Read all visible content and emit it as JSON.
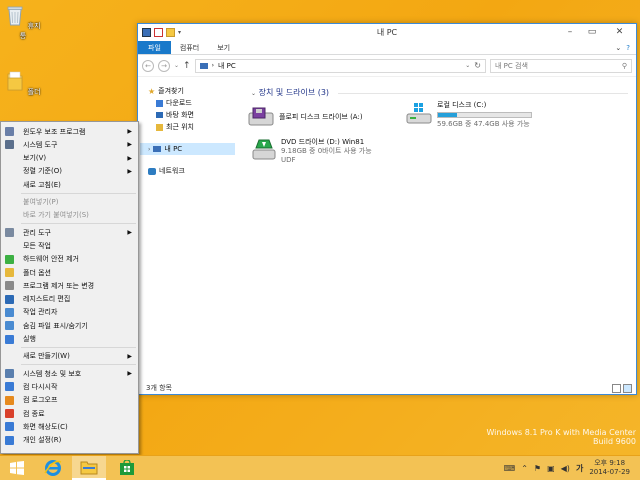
{
  "desktop": {
    "icons": [
      {
        "label": "휴지통",
        "icon": "recycle-bin-icon"
      },
      {
        "label": "폴더",
        "icon": "folder-icon"
      }
    ],
    "watermark": {
      "line1": "Windows 8.1 Pro K with Media Center",
      "line2": "Build 9600"
    }
  },
  "explorer": {
    "title": "내 PC",
    "ribbon_tabs": [
      "파일",
      "컴퓨터",
      "보기"
    ],
    "address": {
      "path": "내 PC",
      "search_placeholder": "내 PC 검색"
    },
    "nav_pane": {
      "favorites": "즐겨찾기",
      "favorite_items": [
        "다운로드",
        "바탕 화면",
        "최근 위치"
      ],
      "this_pc": "내 PC",
      "network": "네트워크"
    },
    "section_title": "장치 및 드라이브 (3)",
    "drives": [
      {
        "name": "플로피 디스크 드라이브 (A:)",
        "detail": "",
        "extra": ""
      },
      {
        "name": "로컬 디스크 (C:)",
        "detail": "59.6GB 중 47.4GB 사용 가능",
        "used_fraction": 0.2
      },
      {
        "name": "DVD 드라이브 (D:) Win81",
        "detail": "9.18GB 중 0바이트 사용 가능",
        "extra": "UDF"
      }
    ],
    "status": "3개 항목"
  },
  "context_menu": {
    "items": [
      {
        "label": "윈도우 보조 프로그램",
        "submenu": true,
        "disabled": false
      },
      {
        "label": "시스템 도구",
        "submenu": true,
        "disabled": false
      },
      {
        "label": "보기(V)",
        "submenu": true,
        "disabled": false
      },
      {
        "label": "정렬 기준(O)",
        "submenu": true,
        "disabled": false
      },
      {
        "label": "새로 고침(E)",
        "submenu": false,
        "disabled": false
      },
      {
        "label": "붙여넣기(P)",
        "submenu": false,
        "disabled": true
      },
      {
        "label": "바로 가기 붙여넣기(S)",
        "submenu": false,
        "disabled": true
      },
      {
        "label": "관리 도구",
        "submenu": true,
        "disabled": false
      },
      {
        "label": "모든 작업",
        "submenu": false,
        "disabled": false
      },
      {
        "label": "하드웨어 안전 제거",
        "submenu": false,
        "disabled": false
      },
      {
        "label": "폴더 옵션",
        "submenu": false,
        "disabled": false
      },
      {
        "label": "프로그램 제거 또는 변경",
        "submenu": false,
        "disabled": false
      },
      {
        "label": "레지스트리 편집",
        "submenu": false,
        "disabled": false
      },
      {
        "label": "작업 관리자",
        "submenu": false,
        "disabled": false
      },
      {
        "label": "숨김 파일 표시/숨기기",
        "submenu": false,
        "disabled": false
      },
      {
        "label": "실행",
        "submenu": false,
        "disabled": false
      },
      {
        "label": "새로 만들기(W)",
        "submenu": true,
        "disabled": false
      },
      {
        "label": "시스템 청소 및 보호",
        "submenu": true,
        "disabled": false
      },
      {
        "label": "컴 다시시작",
        "submenu": false,
        "disabled": false
      },
      {
        "label": "컴 로그오프",
        "submenu": false,
        "disabled": false
      },
      {
        "label": "컴 종료",
        "submenu": false,
        "disabled": false
      },
      {
        "label": "화면 해상도(C)",
        "submenu": false,
        "disabled": false
      },
      {
        "label": "개인 설정(R)",
        "submenu": false,
        "disabled": false
      }
    ]
  },
  "taskbar": {
    "date": "2014-07-29",
    "time": "오후 9:18"
  },
  "colors": {
    "accent": "#1979ca",
    "desktop": "#f3a712",
    "drive_bar": "#26a0da"
  }
}
